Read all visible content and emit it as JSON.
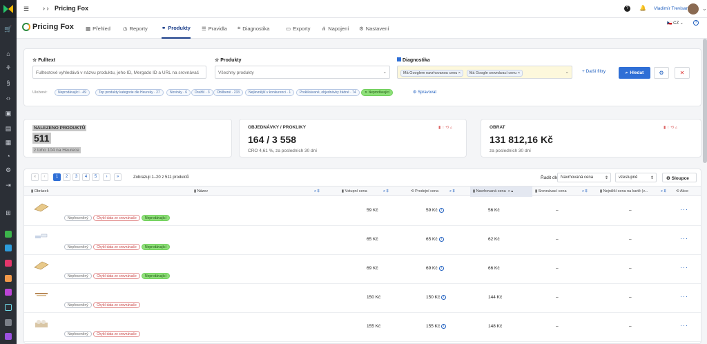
{
  "topbar": {
    "product": "Pricing Fox",
    "user": "Vladimír Trevisan"
  },
  "app": {
    "logo": "Pricing Fox",
    "tabs": [
      "Přehled",
      "Reporty",
      "Produkty",
      "Pravidla",
      "Diagnostika",
      "Exporty",
      "Napojení",
      "Nastavení"
    ],
    "active_tab": "Produkty",
    "lang": "CZ"
  },
  "filters": {
    "fulltext_label": "Fulltext",
    "fulltext_placeholder": "Fulltextové vyhledává v názvu produktu, jeho ID, Mergado ID a URL na srovnávač",
    "produkty_label": "Produkty",
    "produkty_placeholder": "Všechny produkty",
    "diag_label": "Diagnostika",
    "diag_chips": [
      "Má Googlem navrhovanou cenu",
      "Má Google srovnávací cenu"
    ],
    "more_filters": "Další filtry",
    "search": "Hledat",
    "saved_label": "Uložené:",
    "saved": [
      "Neprodávající · 49",
      "Top produkty kategorie dle Heureky · 27",
      "Novinky · 6",
      "Dražší · 3",
      "Oblíbené · 233",
      "Nejlevnější v konkurenci · 1",
      "Proklikávané, objednávky žádné · 74",
      "Neprodávající"
    ],
    "manage": "Spravovat"
  },
  "stats": {
    "found_title": "NALEZENO PRODUKTŮ",
    "found_value": "511",
    "found_sub": "z toho 104 na Heurece",
    "orders_title": "OBJEDNÁVKY / PROKLIKY",
    "orders_value": "164 / 3 558",
    "orders_sub": "CRO 4,61 %, za posledních 30 dní",
    "turnover_title": "OBRAT",
    "turnover_value": "131 812,16 Kč",
    "turnover_sub": "za posledních 30 dní"
  },
  "table": {
    "pages": [
      "1",
      "2",
      "3",
      "4",
      "5"
    ],
    "summary": "Zobrazuji 1–20 z 511 produktů",
    "sort_label": "Řadit dle",
    "sort_value": "Navrhovaná cena",
    "sort_dir": "vzestupně",
    "columns_btn": "Sloupce",
    "headers": [
      "Obrázek",
      "Název",
      "Vstupní cena",
      "Prodejní cena",
      "Navrhovaná cena",
      "Srovnávací cena",
      "Nejnižší cena na kartě (v...",
      "Akce"
    ],
    "rows": [
      {
        "tags": [
          "Nepřeceněný",
          "Chybí data ze srovnávače",
          "Neprodávající"
        ],
        "in": "59 Kč",
        "sell": "59 Kč",
        "sugg": "56 Kč",
        "cmp": "–",
        "low": "–"
      },
      {
        "tags": [
          "Nepřeceněný",
          "Chybí data ze srovnávače",
          "Neprodávající"
        ],
        "in": "65 Kč",
        "sell": "65 Kč",
        "sugg": "62 Kč",
        "cmp": "–",
        "low": "–"
      },
      {
        "tags": [
          "Nepřeceněný",
          "Chybí data ze srovnávače",
          "Neprodávající"
        ],
        "in": "69 Kč",
        "sell": "69 Kč",
        "sugg": "66 Kč",
        "cmp": "–",
        "low": "–"
      },
      {
        "tags": [
          "Nepřeceněný",
          "Chybí data ze srovnávače"
        ],
        "in": "150 Kč",
        "sell": "150 Kč",
        "sugg": "144 Kč",
        "cmp": "–",
        "low": "–"
      },
      {
        "tags": [
          "Nepřeceněný",
          "Chybí data ze srovnávače"
        ],
        "in": "155 Kč",
        "sell": "155 Kč",
        "sugg": "148 Kč",
        "cmp": "–",
        "low": "–"
      }
    ]
  },
  "colors": {
    "rail": "#2b2f36",
    "accent": "#2f6fd6",
    "green_tag": "#8fe07a"
  }
}
